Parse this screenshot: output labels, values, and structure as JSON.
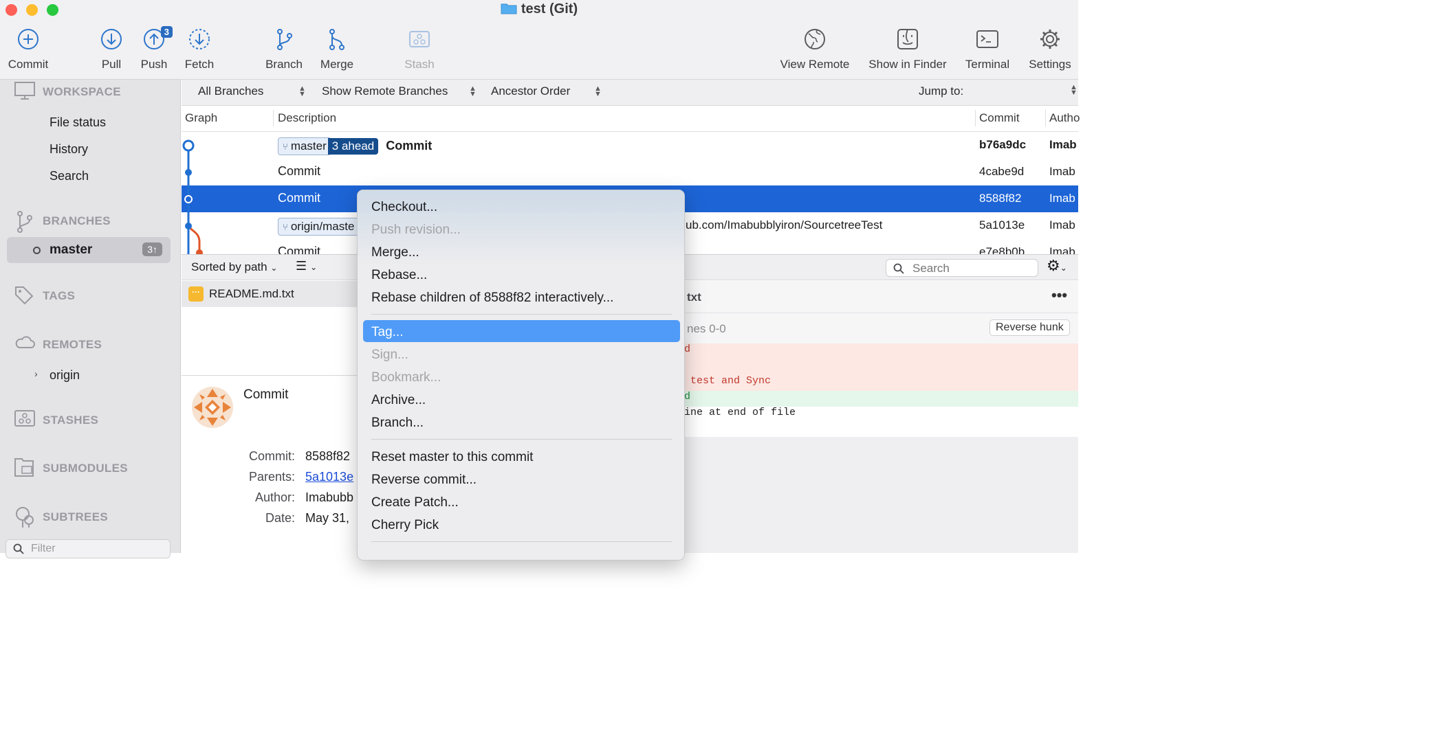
{
  "window": {
    "title": "test (Git)"
  },
  "toolbar": {
    "commit": "Commit",
    "pull": "Pull",
    "push": "Push",
    "push_badge": "3",
    "fetch": "Fetch",
    "branch": "Branch",
    "merge": "Merge",
    "stash": "Stash",
    "view_remote": "View Remote",
    "show_in_finder": "Show in Finder",
    "terminal": "Terminal",
    "settings": "Settings"
  },
  "sidebar": {
    "workspace": "WORKSPACE",
    "workspace_items": [
      "File status",
      "History",
      "Search"
    ],
    "branches": "BRANCHES",
    "branch_selected": "master",
    "branch_count": "3↑",
    "tags": "TAGS",
    "remotes": "REMOTES",
    "remote_item": "origin",
    "stashes": "STASHES",
    "submodules": "SUBMODULES",
    "subtrees": "SUBTREES",
    "filter_placeholder": "Filter"
  },
  "filterbar": {
    "branches": "All Branches",
    "remote": "Show Remote Branches",
    "order": "Ancestor Order",
    "jump": "Jump to:"
  },
  "table": {
    "columns": {
      "graph": "Graph",
      "description": "Description",
      "commit": "Commit",
      "author": "Autho"
    },
    "rows": [
      {
        "branch": "master",
        "ahead": "3 ahead",
        "desc": "Commit",
        "hash": "b76a9dc",
        "author": "Imab"
      },
      {
        "desc": "Commit",
        "hash": "4cabe9d",
        "author": "Imab"
      },
      {
        "desc": "Commit",
        "hash": "8588f82",
        "author": "Imab"
      },
      {
        "branch": "origin/maste",
        "desc_tail": "ub.com/Imabubblyiron/SourcetreeTest",
        "hash": "5a1013e",
        "author": "Imab"
      },
      {
        "desc": "Commit",
        "hash": "e7e8b0b",
        "author": "Imab"
      }
    ]
  },
  "files": {
    "sort": "Sorted by path",
    "search_placeholder": "Search",
    "items": [
      {
        "name": "README.md.txt"
      }
    ]
  },
  "diff": {
    "file_tail": "txt",
    "hunk": "nes 0-0",
    "reverse": "Reverse hunk",
    "lines": [
      {
        "text": "d",
        "kind": "removed"
      },
      {
        "text": "",
        "kind": "removed"
      },
      {
        "text": " test and Sync",
        "kind": "removed"
      },
      {
        "text": "d",
        "kind": "added"
      },
      {
        "text": "ine at end of file",
        "kind": "context"
      }
    ]
  },
  "details": {
    "subject": "Commit",
    "commit_label": "Commit:",
    "commit_val": "8588f82",
    "parents_label": "Parents:",
    "parents_val": "5a1013e",
    "author_label": "Author:",
    "author_val": "Imabubb",
    "date_label": "Date:",
    "date_val": "May 31,"
  },
  "context_menu": {
    "items": [
      {
        "label": "Checkout...",
        "enabled": true
      },
      {
        "label": "Push revision...",
        "enabled": false
      },
      {
        "label": "Merge...",
        "enabled": true
      },
      {
        "label": "Rebase...",
        "enabled": true
      },
      {
        "label": "Rebase children of 8588f82 interactively...",
        "enabled": true
      },
      {
        "label": "Tag...",
        "enabled": true,
        "highlighted": true
      },
      {
        "label": "Sign...",
        "enabled": false
      },
      {
        "label": "Bookmark...",
        "enabled": false
      },
      {
        "label": "Archive...",
        "enabled": true
      },
      {
        "label": "Branch...",
        "enabled": true
      },
      {
        "label": "Reset master to this commit",
        "enabled": true
      },
      {
        "label": "Reverse commit...",
        "enabled": true
      },
      {
        "label": "Create Patch...",
        "enabled": true
      },
      {
        "label": "Cherry Pick",
        "enabled": true
      }
    ]
  },
  "colors": {
    "accent": "#1d64d6",
    "menu_highlight": "#4f9bf7",
    "graph_blue": "#1f6fd1",
    "graph_orange": "#e0562a"
  }
}
